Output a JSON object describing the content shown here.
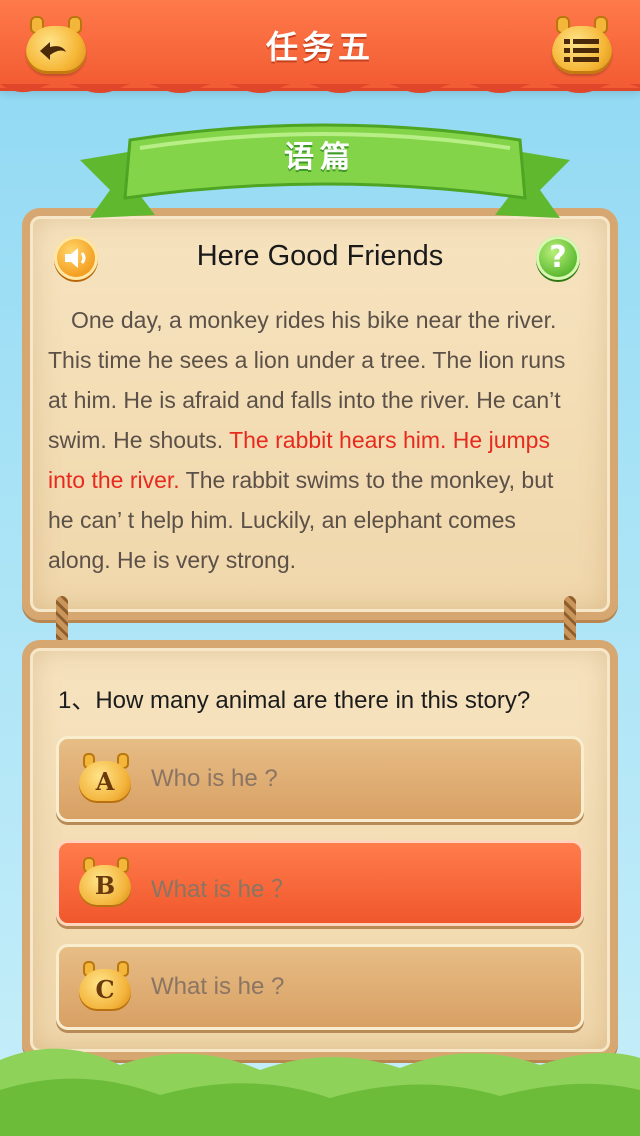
{
  "header": {
    "title": "任务五",
    "back_icon": "back-arrow-icon",
    "menu_icon": "menu-list-icon"
  },
  "section": {
    "ribbon_label": "语篇"
  },
  "story": {
    "title": "Here Good Friends",
    "speaker_icon": "speaker-icon",
    "help_label": "?",
    "text_before": "One day, a monkey rides his bike near the river. This time he sees a lion under a tree. The lion runs at him. He is afraid and falls into the river. He can’t swim. He shouts. ",
    "text_highlight": "The rabbit hears him. He jumps into the river.",
    "text_after": " The rabbit swims to the monkey, but he can’ t help him. Luckily, an elephant comes along. He is very strong."
  },
  "quiz": {
    "question": "1、How many animal are there in this story?",
    "options": [
      {
        "letter": "A",
        "text": "Who is he ?",
        "selected": false
      },
      {
        "letter": "B",
        "text": "What is he ？",
        "selected": true
      },
      {
        "letter": "C",
        "text": "What is he ?",
        "selected": false
      }
    ]
  },
  "colors": {
    "header": "#f25b33",
    "selected_option": "#f0572c",
    "option": "#d8a064",
    "highlight_text": "#e62b1e",
    "ribbon": "#7ccf3f"
  }
}
